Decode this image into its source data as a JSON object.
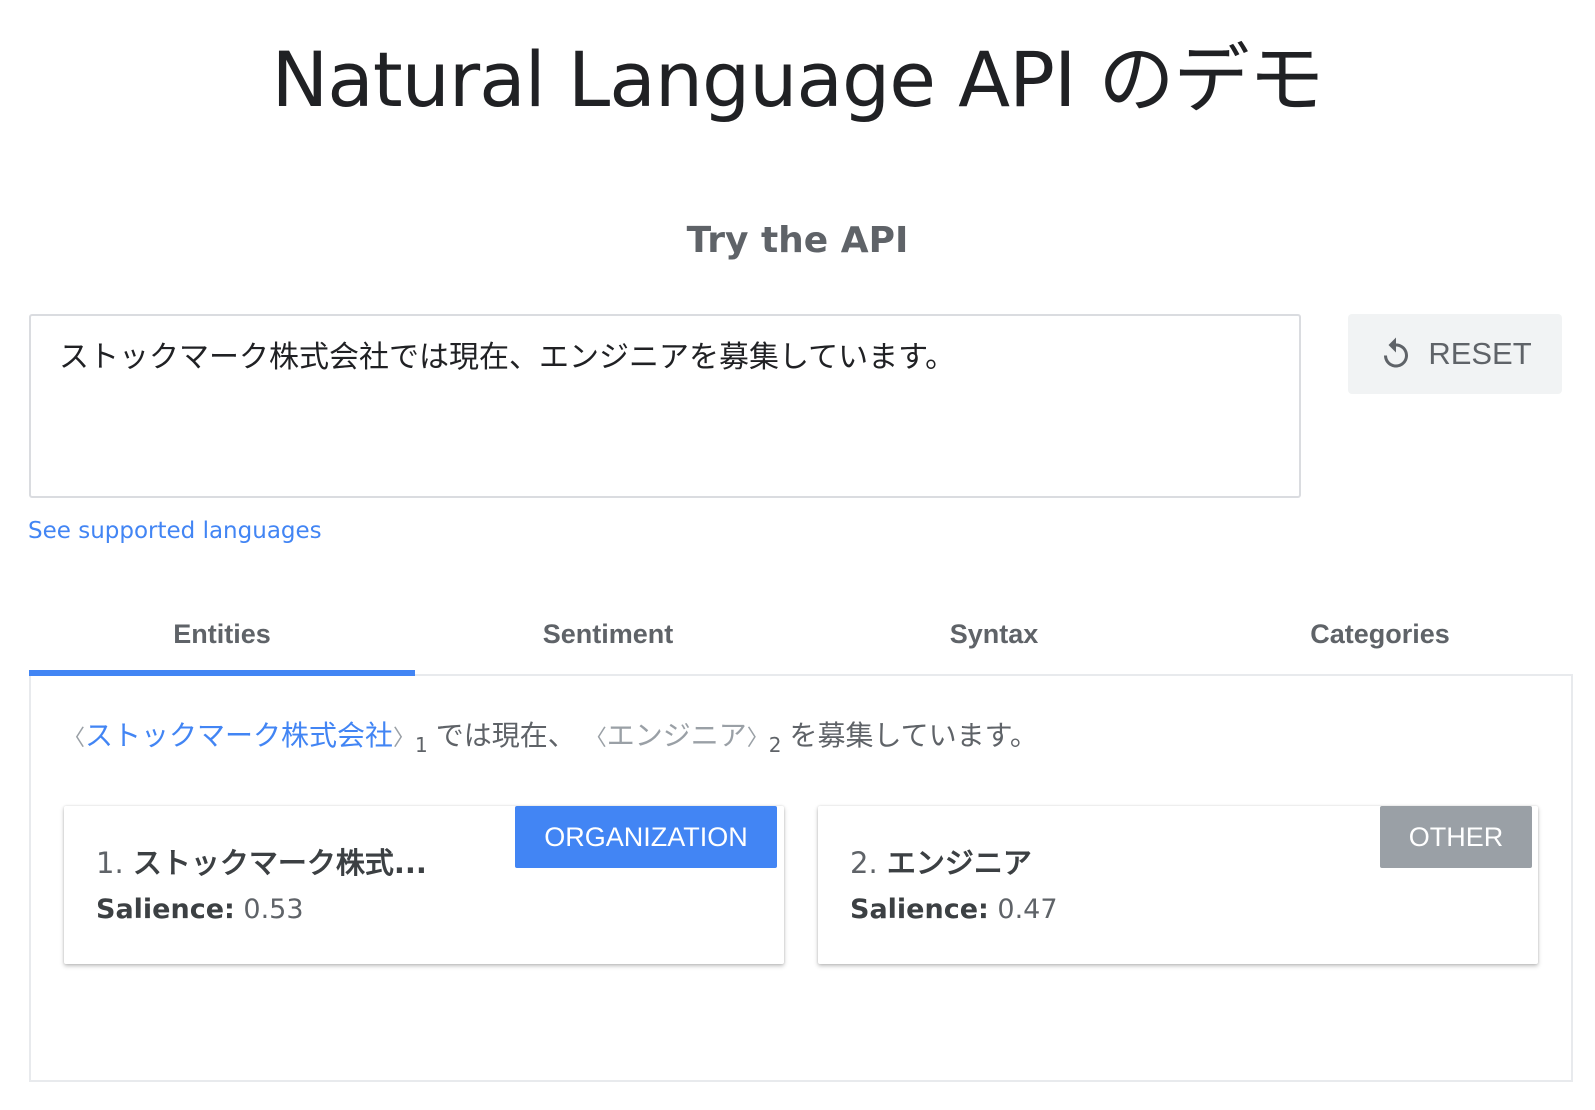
{
  "header": {
    "title": "Natural Language API のデモ",
    "section_title": "Try the API"
  },
  "input": {
    "value": "ストックマーク株式会社では現在、エンジニアを募集しています。"
  },
  "reset_button": {
    "label": "RESET",
    "icon": "reset-icon"
  },
  "languages_link": "See supported languages",
  "tabs": [
    {
      "label": "Entities",
      "active": true
    },
    {
      "label": "Sentiment",
      "active": false
    },
    {
      "label": "Syntax",
      "active": false
    },
    {
      "label": "Categories",
      "active": false
    }
  ],
  "annotated": {
    "entity_1": "ストックマーク株式会社",
    "entity_1_index": "1",
    "text_between": "では現在、",
    "entity_2": "エンジニア",
    "entity_2_index": "2",
    "text_after": "を募集しています。"
  },
  "entities": [
    {
      "number": "1.",
      "name": "ストックマーク株式...",
      "salience_label": "Salience:",
      "salience": "0.53",
      "type": "ORGANIZATION",
      "type_color": "#4285f4"
    },
    {
      "number": "2.",
      "name": "エンジニア",
      "salience_label": "Salience:",
      "salience": "0.47",
      "type": "OTHER",
      "type_color": "#9aa0a6"
    }
  ],
  "colors": {
    "accent": "#4285f4",
    "muted": "#9aa0a6"
  }
}
